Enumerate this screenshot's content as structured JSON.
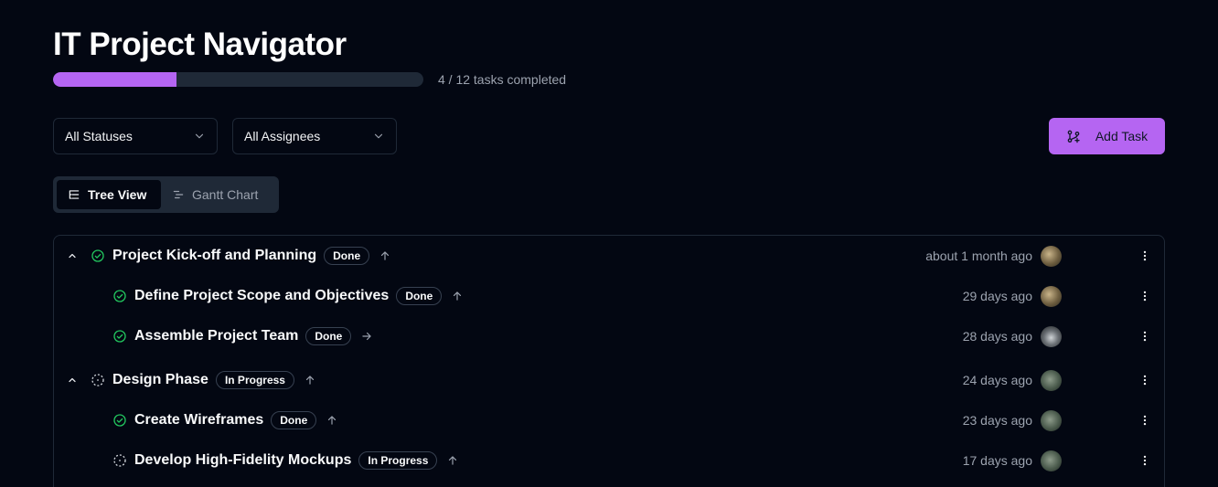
{
  "app": {
    "title": "IT Project Navigator"
  },
  "progress": {
    "completed": 4,
    "total": 12,
    "fraction": 0.3333,
    "text": "4 / 12 tasks completed"
  },
  "filters": {
    "status": {
      "value": "All Statuses"
    },
    "assignee": {
      "value": "All Assignees"
    }
  },
  "actions": {
    "add_task": "Add Task"
  },
  "view_tabs": [
    {
      "label": "Tree View",
      "icon": "list-tree-icon",
      "active": true
    },
    {
      "label": "Gantt Chart",
      "icon": "gantt-chart-icon",
      "active": false
    }
  ],
  "colors": {
    "accent": "#b565f2",
    "done": "#22c55e",
    "background": "#030712"
  },
  "tasks": [
    {
      "title": "Project Kick-off and Planning",
      "status": "Done",
      "status_icon": "check-circle-icon",
      "priority_icon": "arrow-up-icon",
      "updated": "about 1 month ago",
      "avatar": "av1",
      "level": 0,
      "expandable": true
    },
    {
      "title": "Define Project Scope and Objectives",
      "status": "Done",
      "status_icon": "check-circle-icon",
      "priority_icon": "arrow-up-icon",
      "updated": "29 days ago",
      "avatar": "av1",
      "level": 1,
      "expandable": false
    },
    {
      "title": "Assemble Project Team",
      "status": "Done",
      "status_icon": "check-circle-icon",
      "priority_icon": "arrow-right-icon",
      "updated": "28 days ago",
      "avatar": "av2",
      "level": 1,
      "expandable": false
    },
    {
      "title": "Design Phase",
      "status": "In Progress",
      "status_icon": "dashed-circle-icon",
      "priority_icon": "arrow-up-icon",
      "updated": "24 days ago",
      "avatar": "av3",
      "level": 0,
      "expandable": true
    },
    {
      "title": "Create Wireframes",
      "status": "Done",
      "status_icon": "check-circle-icon",
      "priority_icon": "arrow-up-icon",
      "updated": "23 days ago",
      "avatar": "av3",
      "level": 1,
      "expandable": false
    },
    {
      "title": "Develop High-Fidelity Mockups",
      "status": "In Progress",
      "status_icon": "dashed-circle-icon",
      "priority_icon": "arrow-up-icon",
      "updated": "17 days ago",
      "avatar": "av3",
      "level": 1,
      "expandable": false
    }
  ]
}
